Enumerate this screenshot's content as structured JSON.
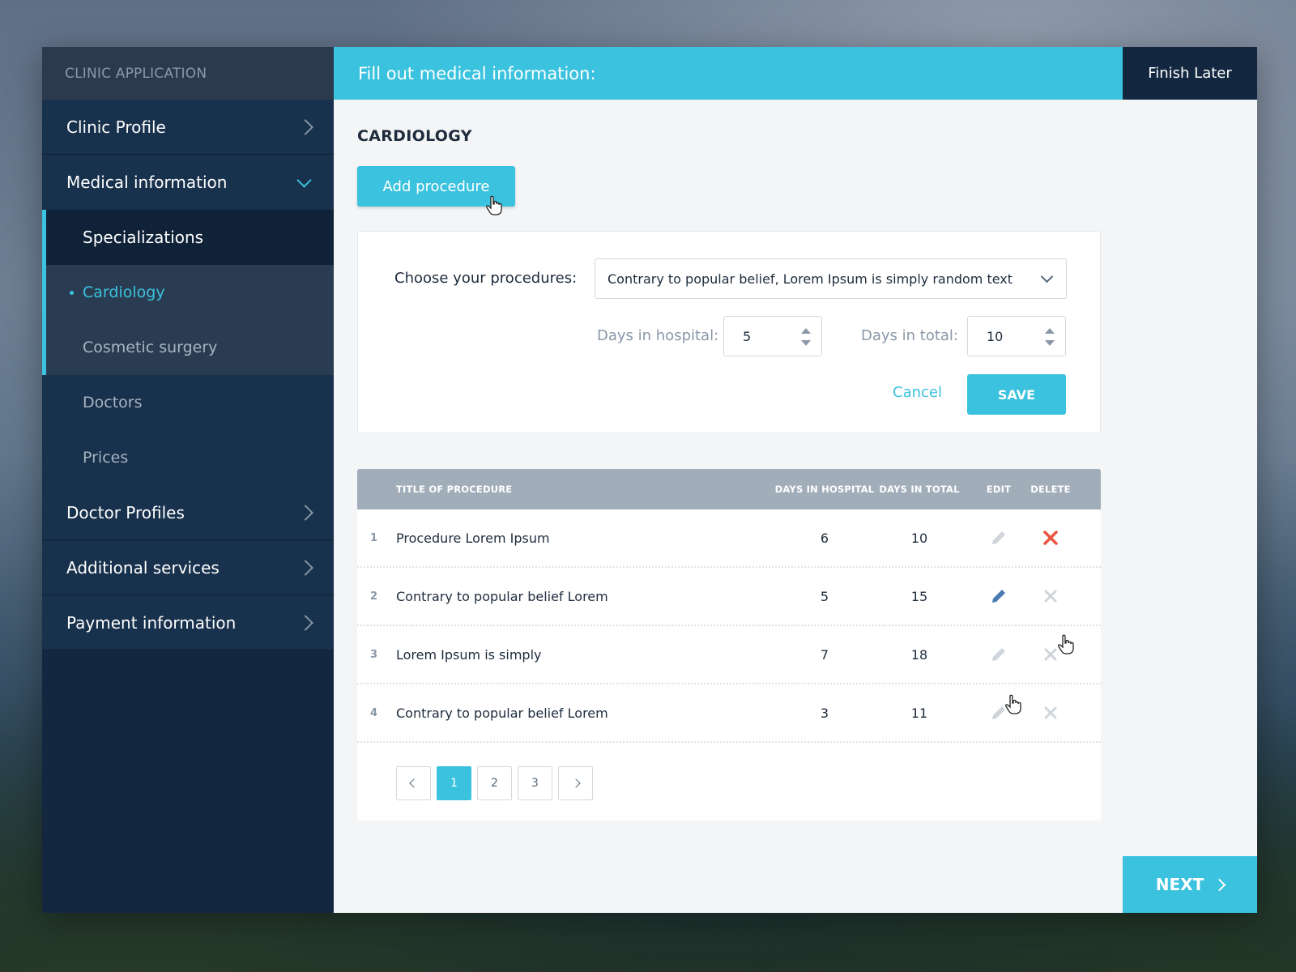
{
  "sidebar": {
    "header": "CLINIC APPLICATION",
    "items": {
      "clinic_profile": "Clinic Profile",
      "medical_information": "Medical information",
      "specializations": "Specializations",
      "cardiology": "Cardiology",
      "cosmetic_surgery": "Cosmetic surgery",
      "doctors": "Doctors",
      "prices": "Prices",
      "doctor_profiles": "Doctor Profiles",
      "additional_services": "Additional services",
      "payment_information": "Payment information"
    }
  },
  "topbar": {
    "title": "Fill out medical information:",
    "finish_later": "Finish Later"
  },
  "section": {
    "title": "CARDIOLOGY",
    "add_procedure": "Add procedure"
  },
  "form": {
    "choose_label": "Choose your procedures:",
    "selected_procedure": "Contrary to popular belief, Lorem Ipsum is simply random text",
    "days_hospital_label": "Days in hospital:",
    "days_hospital_value": "5",
    "days_total_label": "Days in total:",
    "days_total_value": "10",
    "cancel": "Cancel",
    "save": "SAVE"
  },
  "table": {
    "headers": {
      "title": "TITLE OF PROCEDURE",
      "hospital": "DAYS IN HOSPITAL",
      "total": "DAYS IN TOTAL",
      "edit": "EDIT",
      "delete": "DELETE"
    },
    "rows": [
      {
        "num": "1",
        "title": "Procedure Lorem Ipsum",
        "hospital": "6",
        "total": "10"
      },
      {
        "num": "2",
        "title": "Contrary to popular belief Lorem",
        "hospital": "5",
        "total": "15"
      },
      {
        "num": "3",
        "title": "Lorem Ipsum is simply",
        "hospital": "7",
        "total": "18"
      },
      {
        "num": "4",
        "title": "Contrary to popular belief Lorem",
        "hospital": "3",
        "total": "11"
      }
    ]
  },
  "pagination": {
    "pages": [
      "1",
      "2",
      "3"
    ],
    "current": "1"
  },
  "next_button": "NEXT",
  "colors": {
    "accent": "#3ac2de",
    "sidebar": "#132840",
    "delete_active": "#e8543f",
    "edit_active": "#4a7bb0"
  },
  "icons": {
    "edit": "pencil-icon",
    "delete": "close-icon",
    "expand": "chevron-right-icon",
    "collapse": "chevron-down-icon"
  }
}
